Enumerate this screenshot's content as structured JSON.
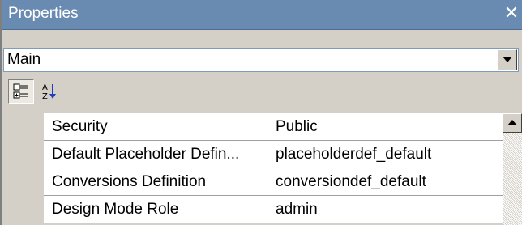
{
  "window": {
    "title": "Properties",
    "close_glyph": "✕",
    "close_icon": "close-icon"
  },
  "object_selector": {
    "value": "Main",
    "dropdown_icon": "chevron-down-icon"
  },
  "toolbar": {
    "categorized_icon": "categorized-view-icon",
    "categorized_active": true,
    "alphabetical_icon": "sort-alphabetical-icon"
  },
  "properties": [
    {
      "name": "Security",
      "value": "Public"
    },
    {
      "name": "Default Placeholder Defin...",
      "value": "placeholderdef_default"
    },
    {
      "name": "Conversions Definition",
      "value": "conversiondef_default"
    },
    {
      "name": "Design Mode Role",
      "value": "admin"
    }
  ],
  "scrollbar": {
    "up_icon": "scroll-up-arrow-icon"
  },
  "colors": {
    "title_bar": "#6a8bb1",
    "panel_face": "#d4d0c8",
    "grid_line": "#a0a0a0"
  }
}
